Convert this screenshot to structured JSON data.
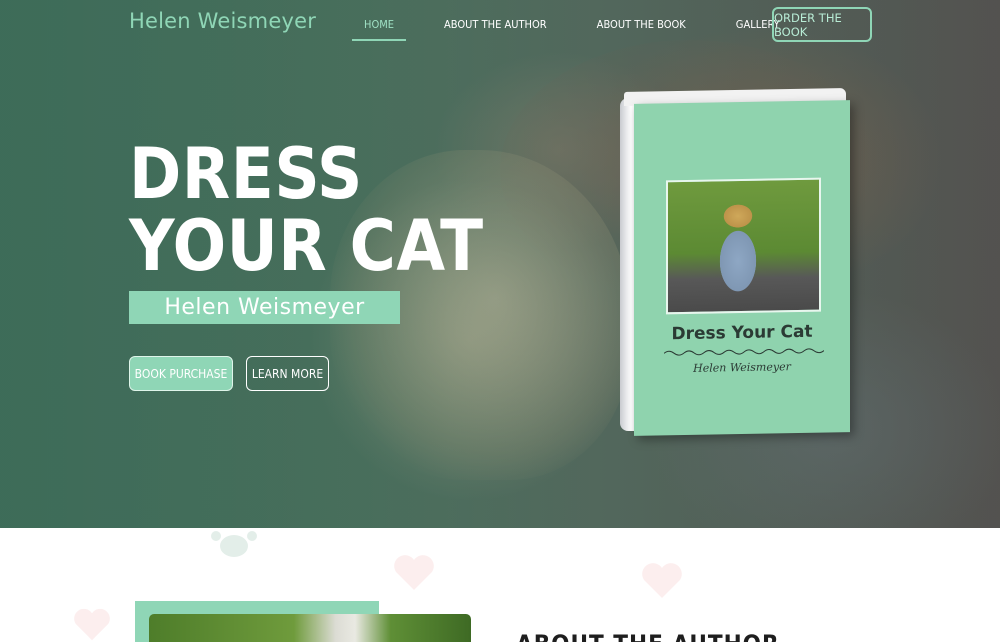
{
  "brand": {
    "name": "Helen Weismeyer"
  },
  "nav": {
    "items": [
      {
        "label": "HOME",
        "active": true
      },
      {
        "label": "ABOUT THE AUTHOR",
        "active": false
      },
      {
        "label": "ABOUT THE BOOK",
        "active": false
      },
      {
        "label": "GALLERY",
        "active": false
      }
    ],
    "cta_label": "ORDER THE BOOK"
  },
  "hero": {
    "title_line1": "DRESS",
    "title_line2": "YOUR CAT",
    "author": "Helen Weismeyer",
    "primary_button": "BOOK PURCHASE",
    "secondary_button": "LEARN MORE"
  },
  "book": {
    "title": "Dress Your Cat",
    "author": "Helen Weismeyer"
  },
  "about": {
    "heading": "ABOUT THE AUTHOR"
  },
  "colors": {
    "accent": "#8fd6b6",
    "hero_overlay": "#3f6a57",
    "book_cover": "#8fd3ae"
  }
}
